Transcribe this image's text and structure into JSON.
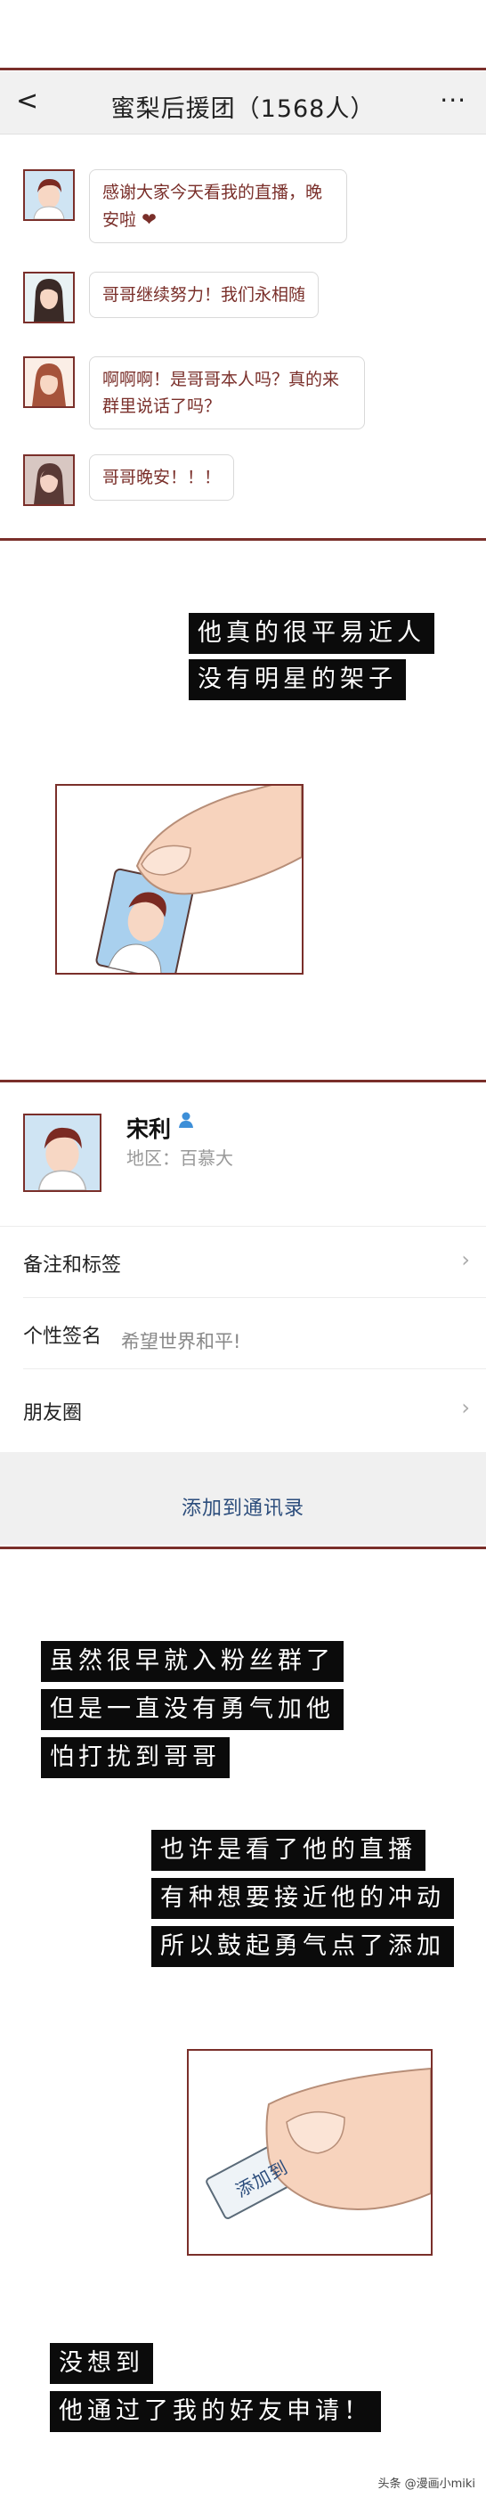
{
  "chat": {
    "back": "<",
    "title": "蜜梨后援团（1568人）",
    "more": "···",
    "messages": [
      {
        "text": "感谢大家今天看我的直播，晚安啦",
        "heart": "❤"
      },
      {
        "text": "哥哥继续努力！我们永相随"
      },
      {
        "text": "啊啊啊！是哥哥本人吗？真的来群里说话了吗？"
      },
      {
        "text": "哥哥晚安！！！"
      }
    ]
  },
  "caption1": [
    "他真的很平易近人",
    "没有明星的架子"
  ],
  "contact": {
    "name": "宋利",
    "region": "地区：百慕大",
    "rows": {
      "remark": "备注和标签",
      "signature_label": "个性签名",
      "signature_value": "希望世界和平!",
      "moments": "朋友圈"
    },
    "add_button": "添加到通讯录",
    "chevron": "›"
  },
  "caption2": [
    "虽然很早就入粉丝群了",
    "但是一直没有勇气加他",
    "怕打扰到哥哥"
  ],
  "caption3": [
    "也许是看了他的直播",
    "有种想要接近他的冲动",
    "所以鼓起勇气点了添加"
  ],
  "button_in_art": "添加到",
  "caption4": [
    "没想到",
    "他通过了我的好友申请！"
  ],
  "watermark": "头条 @漫画小miki"
}
